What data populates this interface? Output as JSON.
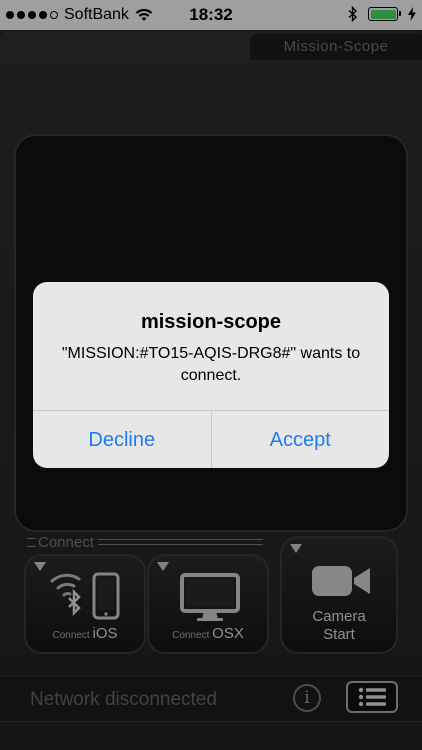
{
  "status_bar": {
    "carrier": "SoftBank",
    "time": "18:32",
    "signal_bars_filled": 4,
    "signal_bars_total": 5,
    "battery_level": 1.0,
    "icons": [
      "wifi-icon",
      "bluetooth-icon",
      "battery-icon",
      "charging-icon"
    ]
  },
  "app": {
    "title": "Mission-Scope",
    "connect_group_label": "Connect",
    "buttons": {
      "ios": {
        "prefix": "Connect",
        "name": "iOS"
      },
      "osx": {
        "prefix": "Connect",
        "name": "OSX"
      },
      "camera": {
        "line1": "Camera",
        "line2": "Start"
      }
    },
    "network_status": "Network disconnected",
    "info_glyph": "i"
  },
  "alert": {
    "title": "mission-scope",
    "message": "\"MISSION:#TO15-AQIS-DRG8#\" wants to connect.",
    "decline_label": "Decline",
    "accept_label": "Accept"
  },
  "colors": {
    "accent": "#1e7cf2",
    "battery": "#4cd964",
    "background": "#262626"
  }
}
